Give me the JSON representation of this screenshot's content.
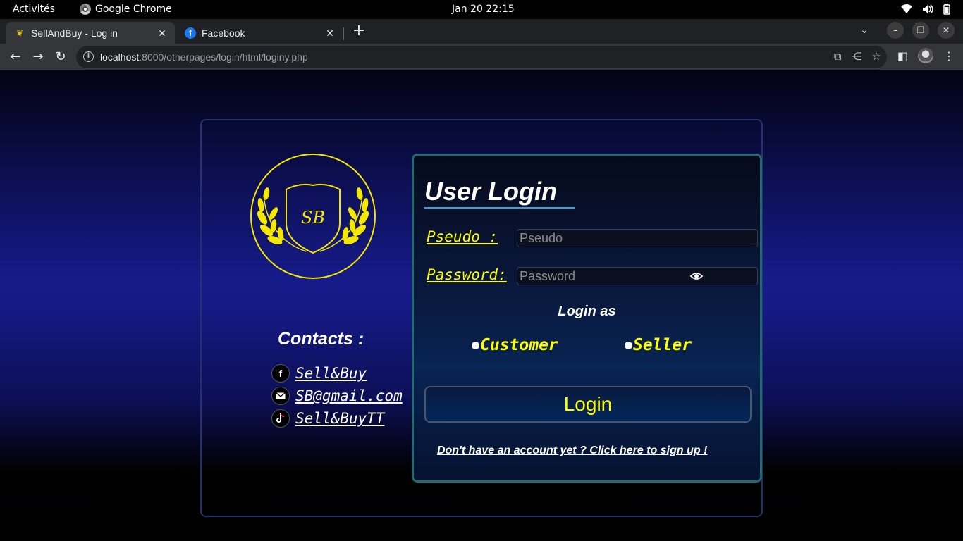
{
  "topbar": {
    "activities": "Activités",
    "app_name": "Google Chrome",
    "clock": "Jan 20  22:15"
  },
  "browser": {
    "tabs": [
      {
        "title": "SellAndBuy - Log in",
        "favicon": "laurel-icon",
        "active": true
      },
      {
        "title": "Facebook",
        "favicon": "facebook-icon",
        "active": false
      }
    ],
    "url_host": "localhost",
    "url_rest": ":8000/otherpages/login/html/loginy.php"
  },
  "page": {
    "logo_monogram": "SB",
    "contacts_title": "Contacts :",
    "contacts": [
      {
        "icon": "facebook-icon",
        "label": "Sell&Buy"
      },
      {
        "icon": "mail-icon",
        "label": "SB@gmail.com"
      },
      {
        "icon": "tiktok-icon",
        "label": "Sell&BuyTT"
      }
    ],
    "login": {
      "title": "User Login",
      "pseudo_label": "Pseudo :",
      "pseudo_placeholder": "Pseudo",
      "password_label": "Password:",
      "password_placeholder": "Password",
      "login_as": "Login as",
      "role_customer": "Customer",
      "role_seller": "Seller",
      "button": "Login",
      "signup_link": "Don't have an account yet ? Click here to sign up !"
    }
  },
  "colors": {
    "accent_yellow": "#ffff00",
    "panel_border": "#1f6b70",
    "logo_gold": "#f5e800"
  }
}
